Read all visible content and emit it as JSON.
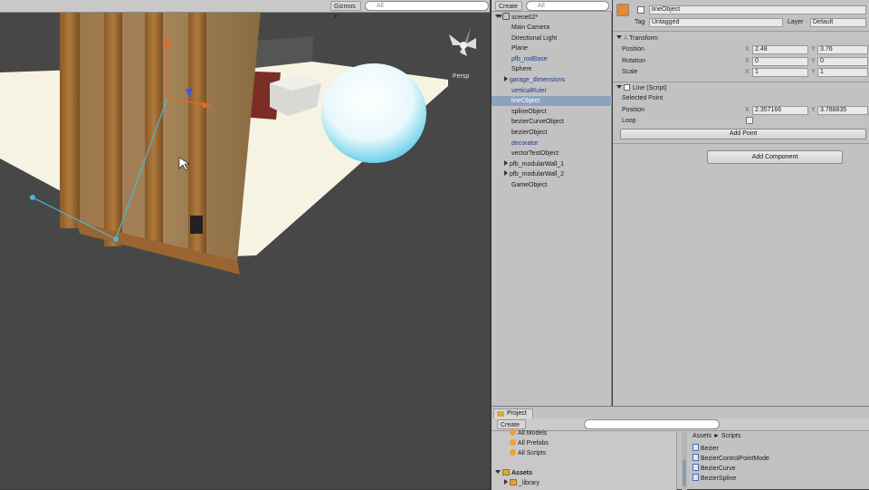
{
  "scene": {
    "gizmo_label": "Persp",
    "toolbar": {
      "gizmos_label": "Gizmos",
      "search_placeholder": "All"
    }
  },
  "hierarchy": {
    "create_label": "Create",
    "search_placeholder": "All",
    "scene_name": "scene02*",
    "items": [
      {
        "label": "Main Camera",
        "style": "normal",
        "arrow": false
      },
      {
        "label": "Directional Light",
        "style": "normal",
        "arrow": false
      },
      {
        "label": "Plane",
        "style": "normal",
        "arrow": false
      },
      {
        "label": "pfb_rodBase",
        "style": "blue",
        "arrow": false
      },
      {
        "label": "Sphere",
        "style": "normal",
        "arrow": false
      },
      {
        "label": "garage_dimensions",
        "style": "blue",
        "arrow": true
      },
      {
        "label": "verticalRuler",
        "style": "blue",
        "arrow": false
      },
      {
        "label": "lineObject",
        "style": "selected",
        "arrow": false
      },
      {
        "label": "splineObject",
        "style": "normal",
        "arrow": false
      },
      {
        "label": "bezierCurveObject",
        "style": "normal",
        "arrow": false
      },
      {
        "label": "bezierObject",
        "style": "normal",
        "arrow": false
      },
      {
        "label": "decorator",
        "style": "blue",
        "arrow": false
      },
      {
        "label": "vectorTestObject",
        "style": "normal",
        "arrow": false
      },
      {
        "label": "pfb_modularWall_1",
        "style": "normal",
        "arrow": true
      },
      {
        "label": "pfb_modularWall_2",
        "style": "normal",
        "arrow": true
      },
      {
        "label": "GameObject",
        "style": "normal",
        "arrow": false
      }
    ]
  },
  "inspector": {
    "object_name": "lineObject",
    "tag_label": "Tag",
    "tag_value": "Untagged",
    "layer_label": "Layer",
    "layer_value": "Default",
    "transform": {
      "title": "Transform",
      "rows": [
        {
          "label": "Position",
          "x": "2.48",
          "y": "3.76"
        },
        {
          "label": "Rotation",
          "x": "0",
          "y": "0"
        },
        {
          "label": "Scale",
          "x": "1",
          "y": "1"
        }
      ]
    },
    "line_script": {
      "title": "Line (Script)",
      "selected_point_label": "Selected Point",
      "position_label": "Position",
      "pos_x": "2.357166",
      "pos_y": "3.788835",
      "loop_label": "Loop",
      "add_point_label": "Add Point"
    },
    "add_component_label": "Add Component"
  },
  "project": {
    "tab_label": "Project",
    "create_label": "Create",
    "breadcrumb_root": "Assets",
    "breadcrumb_sep": "►",
    "breadcrumb_folder": "Scripts",
    "favorites": [
      "All Models",
      "All Prefabs",
      "All Scripts"
    ],
    "assets_label": "Assets",
    "assets_child": "_library",
    "files": [
      "Bezier",
      "BezierControlPointMode",
      "BezierCurve",
      "BezierSpline"
    ]
  },
  "colors": {
    "selection": "#8da2bd",
    "panel": "#c2c2c2",
    "scene_bg": "#474747"
  }
}
